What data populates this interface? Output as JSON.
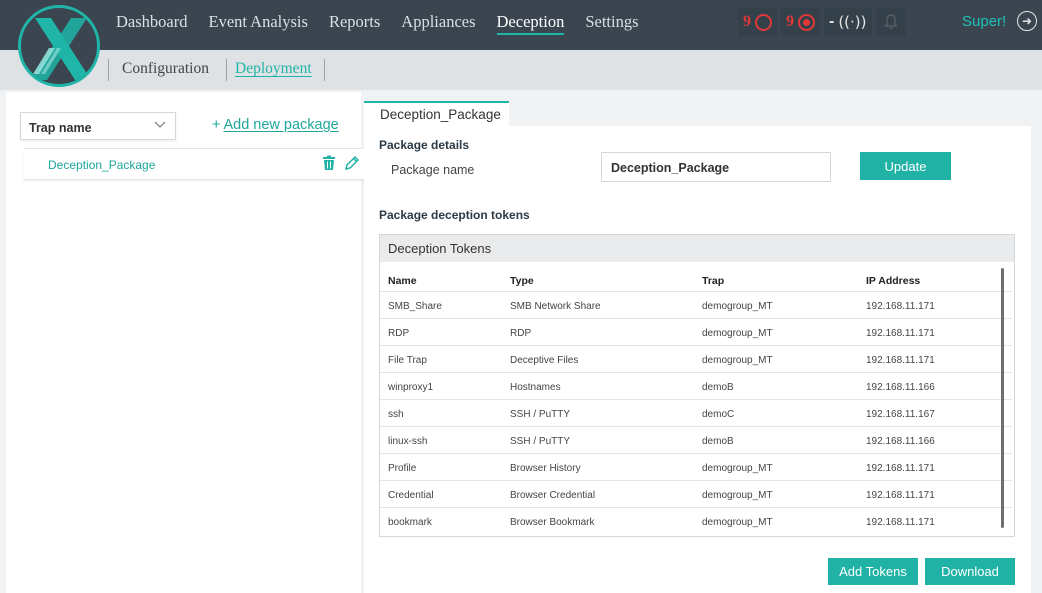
{
  "nav": {
    "items": [
      "Dashboard",
      "Event Analysis",
      "Reports",
      "Appliances",
      "Deception",
      "Settings"
    ],
    "active": "Deception"
  },
  "status": {
    "alerts_open": "9",
    "alerts_active": "9",
    "signal_value": "-",
    "signal_icon": "((·))"
  },
  "user": {
    "name": "Super!"
  },
  "subnav": {
    "items": [
      "Configuration",
      "Deployment"
    ],
    "active": "Deployment"
  },
  "left": {
    "select_label": "Trap name",
    "add_package": "Add new package",
    "add_package_plus": "+",
    "packages": [
      "Deception_Package"
    ]
  },
  "tab": {
    "label": "Deception_Package"
  },
  "details": {
    "title": "Package details",
    "name_label": "Package name",
    "name_value": "Deception_Package",
    "update_label": "Update",
    "tokens_title": "Package deception tokens"
  },
  "tokens": {
    "title": "Deception Tokens",
    "columns": [
      "Name",
      "Type",
      "Trap",
      "IP Address"
    ],
    "rows": [
      [
        "SMB_Share",
        "SMB Network Share",
        "demogroup_MT",
        "192.168.11.171"
      ],
      [
        "RDP",
        "RDP",
        "demogroup_MT",
        "192.168.11.171"
      ],
      [
        "File Trap",
        "Deceptive Files",
        "demogroup_MT",
        "192.168.11.171"
      ],
      [
        "winproxy1",
        "Hostnames",
        "demoB",
        "192.168.11.166"
      ],
      [
        "ssh",
        "SSH / PuTTY",
        "demoC",
        "192.168.11.167"
      ],
      [
        "linux-ssh",
        "SSH / PuTTY",
        "demoB",
        "192.168.11.166"
      ],
      [
        "Profile",
        "Browser History",
        "demogroup_MT",
        "192.168.11.171"
      ],
      [
        "Credential",
        "Browser Credential",
        "demogroup_MT",
        "192.168.11.171"
      ],
      [
        "bookmark",
        "Browser Bookmark",
        "demogroup_MT",
        "192.168.11.171"
      ]
    ]
  },
  "actions": {
    "add_tokens": "Add Tokens",
    "download": "Download"
  },
  "colors": {
    "accent": "#20b2a5",
    "topbar": "#3a4550",
    "alert": "#e03838"
  }
}
